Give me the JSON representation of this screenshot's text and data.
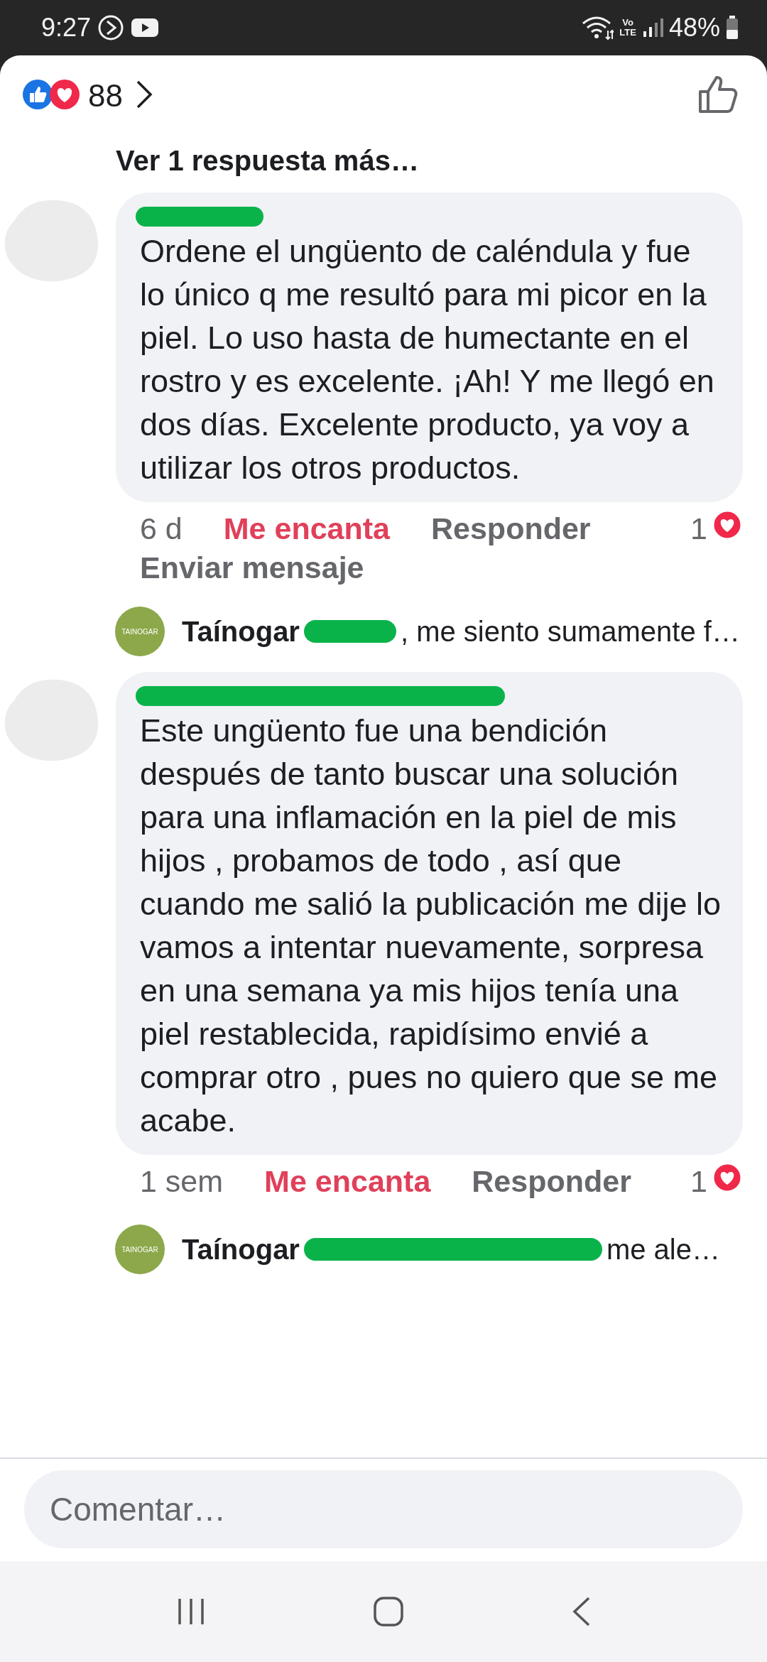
{
  "status_bar": {
    "time": "9:27",
    "network_label": [
      "Vo",
      "LTE"
    ],
    "battery": "48%"
  },
  "reactions": {
    "count": "88"
  },
  "more_replies": "Ver 1 respuesta más…",
  "comments": [
    {
      "body": "Ordene el ungüento de caléndula y fue lo único q me resultó para mi picor en la piel. Lo uso hasta de humectante en el rostro y es excelente. ¡Ah! Y me llegó en dos días. Excelente producto, ya voy a utilizar los otros productos.",
      "time": "6 d",
      "reaction_label": "Me encanta",
      "reacted": true,
      "reply_label": "Responder",
      "extra_action": "Enviar mensaje",
      "reaction_count": "1",
      "reply": {
        "logo": "TAINOGAR",
        "author": "Taínogar",
        "text": ", me siento sumamente f…"
      }
    },
    {
      "body": "Este ungüento fue una bendición después de tanto buscar una solución para una inflamación en la piel de mis hijos , probamos de todo , así que cuando me salió la publicación me dije lo vamos a intentar nuevamente, sorpresa en una semana ya mis hijos tenía una piel restablecida, rapidísimo envié a comprar otro , pues no quiero que se me acabe.",
      "time": "1 sem",
      "reaction_label": "Me encanta",
      "reacted": true,
      "reply_label": "Responder",
      "reaction_count": "1",
      "reply": {
        "logo": "TAINOGAR",
        "author": "Taínogar",
        "text": "me ale…"
      }
    }
  ],
  "comment_field": {
    "placeholder": "Comentar…"
  }
}
